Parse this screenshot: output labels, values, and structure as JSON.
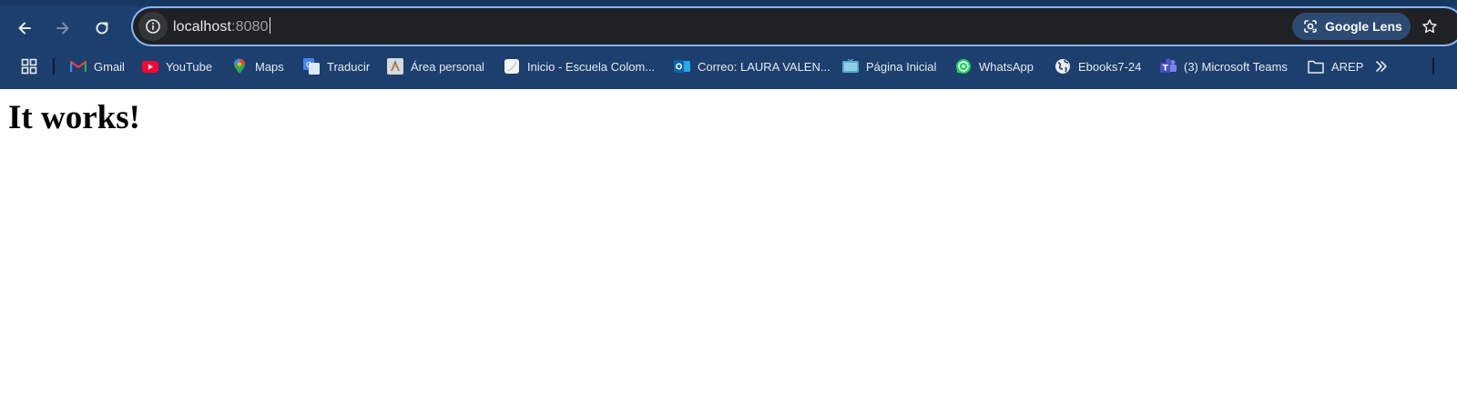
{
  "browser": {
    "address_bar": {
      "host": "localhost",
      "port": ":8080"
    },
    "lens_label": "Google Lens",
    "bookmarks": [
      {
        "label": "Gmail",
        "icon": "gmail-icon"
      },
      {
        "label": "YouTube",
        "icon": "youtube-icon"
      },
      {
        "label": "Maps",
        "icon": "maps-icon"
      },
      {
        "label": "Traducir",
        "icon": "translate-icon"
      },
      {
        "label": "Área personal",
        "icon": "area-personal-icon"
      },
      {
        "label": "Inicio - Escuela Colom...",
        "icon": "page-icon"
      },
      {
        "label": "Correo: LAURA VALEN...",
        "icon": "outlook-icon"
      },
      {
        "label": "Página Inicial",
        "icon": "tv-icon"
      },
      {
        "label": "WhatsApp",
        "icon": "whatsapp-icon"
      },
      {
        "label": "Ebooks7-24",
        "icon": "globe-icon"
      },
      {
        "label": "(3) Microsoft Teams",
        "icon": "teams-icon"
      },
      {
        "label": "AREP",
        "icon": "folder-icon"
      }
    ],
    "colors": {
      "frame": "#1c3f6e",
      "omnibox": "#202124",
      "focus_ring": "#8ab4f8"
    }
  },
  "page": {
    "heading": "It works!"
  }
}
